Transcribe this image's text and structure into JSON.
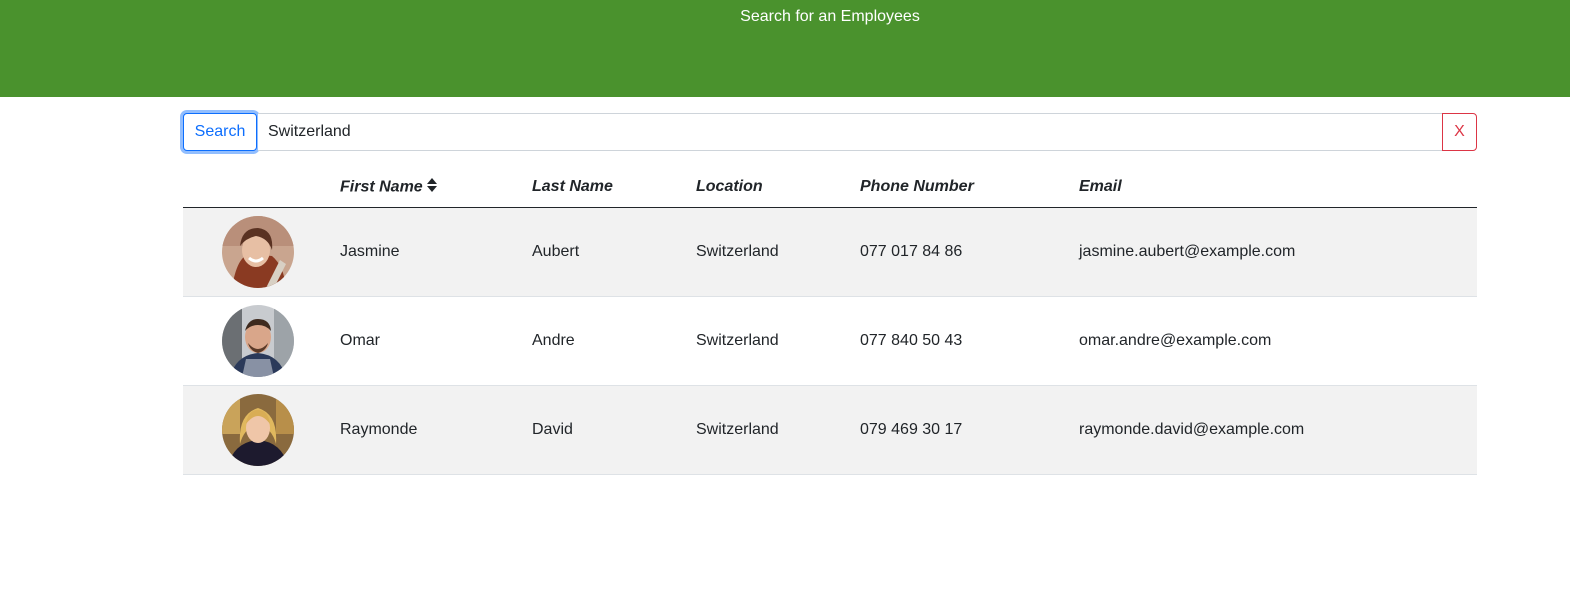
{
  "header": {
    "title": "Search for an Employees"
  },
  "search": {
    "button_label": "Search",
    "value": "Switzerland",
    "clear_label": "X"
  },
  "table": {
    "columns": [
      "First Name",
      "Last Name",
      "Location",
      "Phone Number",
      "Email"
    ],
    "sorted_column": "First Name",
    "rows": [
      {
        "first": "Jasmine",
        "last": "Aubert",
        "location": "Switzerland",
        "phone": "077 017 84 86",
        "email": "jasmine.aubert@example.com"
      },
      {
        "first": "Omar",
        "last": "Andre",
        "location": "Switzerland",
        "phone": "077 840 50 43",
        "email": "omar.andre@example.com"
      },
      {
        "first": "Raymonde",
        "last": "David",
        "location": "Switzerland",
        "phone": "079 469 30 17",
        "email": "raymonde.david@example.com"
      }
    ]
  },
  "colors": {
    "header_bg": "#4a922d",
    "primary": "#0d6efd",
    "danger": "#dc3545",
    "stripe": "#f2f2f2"
  },
  "icons": {
    "sort": "sort-icon",
    "avatar": "avatar-photo"
  }
}
